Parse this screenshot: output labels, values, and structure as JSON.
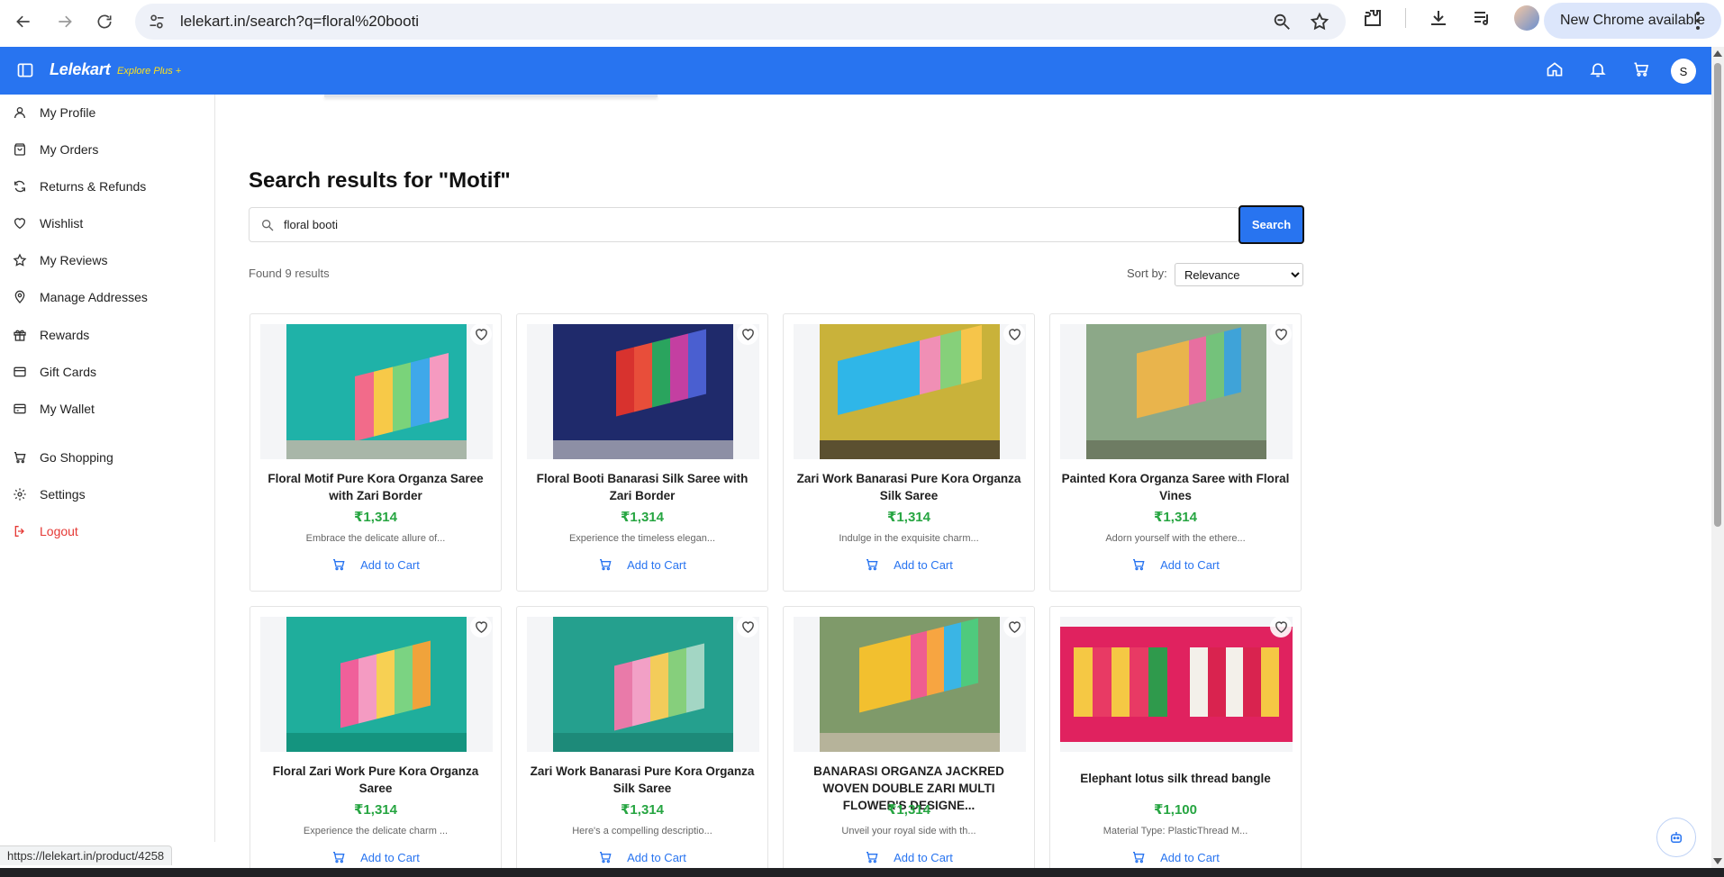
{
  "browser": {
    "url": "lelekart.in/search?q=floral%20booti",
    "new_chrome_label": "New Chrome available"
  },
  "header": {
    "logo": "Lelekart",
    "logo_sub": "Explore Plus +",
    "avatar_initial": "S",
    "brand_color": "#2874f0"
  },
  "sidebar": {
    "items": [
      {
        "label": "My Profile",
        "icon": "user-icon"
      },
      {
        "label": "My Orders",
        "icon": "bag-icon"
      },
      {
        "label": "Returns & Refunds",
        "icon": "refresh-icon"
      },
      {
        "label": "Wishlist",
        "icon": "heart-icon"
      },
      {
        "label": "My Reviews",
        "icon": "star-icon"
      },
      {
        "label": "Manage Addresses",
        "icon": "map-pin-icon"
      },
      {
        "label": "Rewards",
        "icon": "gift-icon"
      },
      {
        "label": "Gift Cards",
        "icon": "card-icon"
      },
      {
        "label": "My Wallet",
        "icon": "wallet-icon"
      },
      {
        "label": "Go Shopping",
        "icon": "cart-icon"
      },
      {
        "label": "Settings",
        "icon": "gear-icon"
      },
      {
        "label": "Logout",
        "icon": "logout-icon"
      }
    ]
  },
  "main": {
    "title": "Search results for \"Motif\"",
    "search_value": "floral booti",
    "search_button": "Search",
    "found_text": "Found 9 results",
    "sort_label": "Sort by:",
    "sort_selected": "Relevance",
    "add_to_cart_label": "Add to Cart",
    "price_color": "#26a541"
  },
  "products": [
    {
      "name": "Floral Motif Pure Kora Organza Saree with Zari Border",
      "price": "₹1,314",
      "desc": "Embrace the delicate allure of..."
    },
    {
      "name": "Floral Booti Banarasi Silk Saree with Zari Border",
      "price": "₹1,314",
      "desc": "Experience the timeless elegan..."
    },
    {
      "name": "Zari Work Banarasi Pure Kora Organza Silk Saree",
      "price": "₹1,314",
      "desc": "Indulge in the exquisite charm..."
    },
    {
      "name": "Painted Kora Organza Saree with Floral Vines",
      "price": "₹1,314",
      "desc": "Adorn yourself with the ethere..."
    },
    {
      "name": "Floral Zari Work Pure Kora Organza Saree",
      "price": "₹1,314",
      "desc": "Experience the delicate charm ..."
    },
    {
      "name": "Zari Work Banarasi Pure Kora Organza Silk Saree",
      "price": "₹1,314",
      "desc": "Here's a compelling descriptio..."
    },
    {
      "name": "BANARASI ORGANZA JACKRED WOVEN DOUBLE ZARI MULTI FLOWER'S DESIGNE...",
      "price": "₹1,314",
      "desc": "Unveil your royal side with th..."
    },
    {
      "name": "Elephant lotus silk thread bangle",
      "price": "₹1,100",
      "desc": "Material Type: PlasticThread M..."
    }
  ],
  "status_bar": {
    "link": "https://lelekart.in/product/4258"
  }
}
